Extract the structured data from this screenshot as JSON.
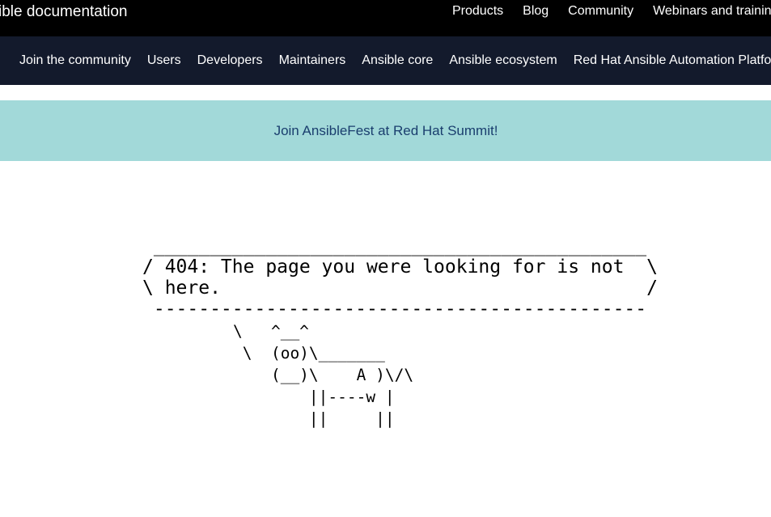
{
  "header": {
    "brand": "ible documentation",
    "nav": [
      "Products",
      "Blog",
      "Community",
      "Webinars and training"
    ]
  },
  "subnav": {
    "items": [
      "Join the community",
      "Users",
      "Developers",
      "Maintainers",
      "Ansible core",
      "Ansible ecosystem",
      "Red Hat Ansible Automation Platform"
    ]
  },
  "banner": {
    "text": "Join AnsibleFest at Red Hat Summit!"
  },
  "error": {
    "bubble": " ____________________________________________\n/ 404: The page you were looking for is not  \\\n\\ here.                                      /\n --------------------------------------------",
    "cow": "\\   ^__^\n \\  (oo)\\_______\n    (__)\\    A )\\/\\\n        ||----w |\n        ||     ||"
  },
  "colors": {
    "topbar": "#000000",
    "subnav": "#131a2c",
    "banner_bg": "#a2d9d9",
    "banner_text": "#1a3e6e"
  }
}
